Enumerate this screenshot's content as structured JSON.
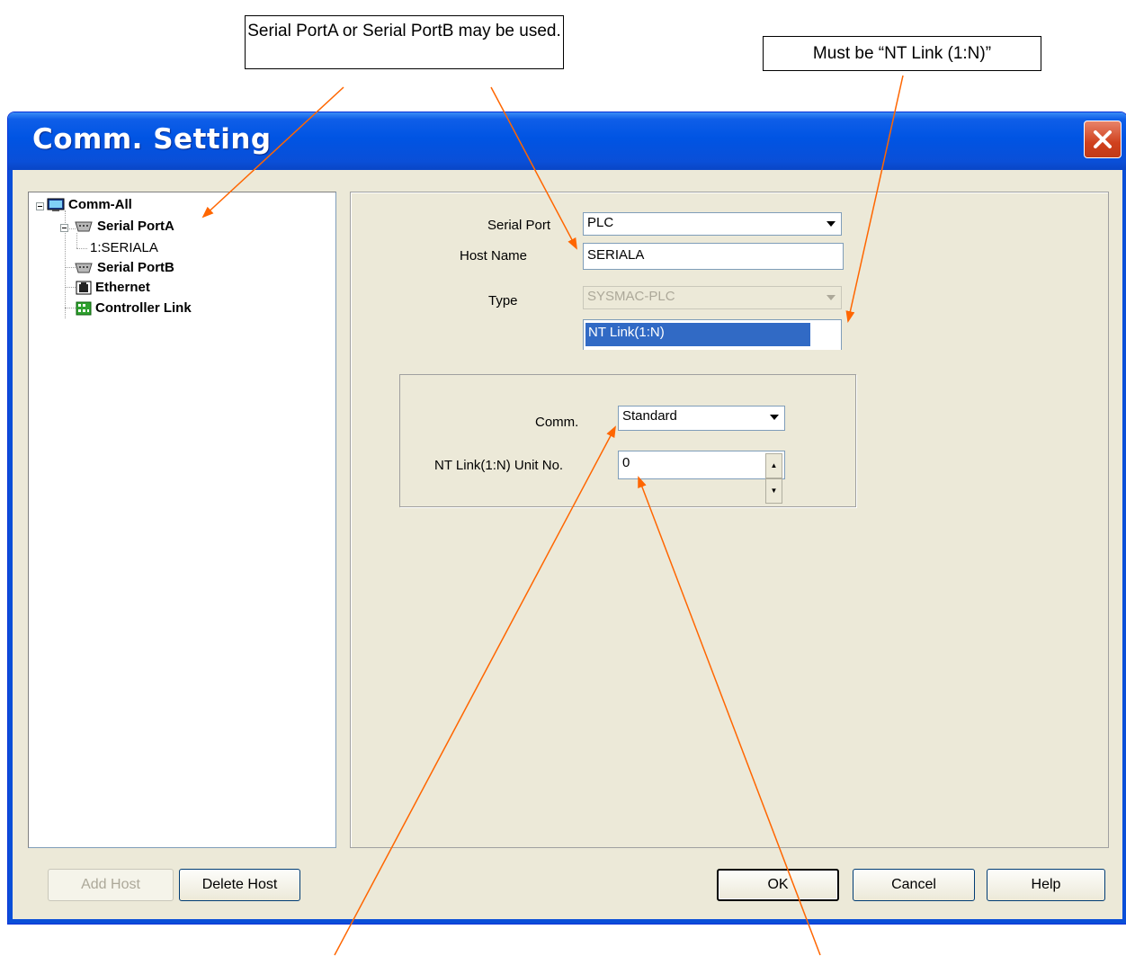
{
  "callouts": {
    "ports": "Serial PortA or Serial PortB may be used.",
    "link": "Must be “NT Link (1:N)”"
  },
  "dialog": {
    "title": "Comm. Setting"
  },
  "tree": {
    "root": "Comm-All",
    "items": [
      {
        "label": "Serial PortA",
        "icon": "serial-port-icon"
      },
      {
        "label": "1:SERIALA",
        "icon": ""
      },
      {
        "label": "Serial PortB",
        "icon": "serial-port-icon"
      },
      {
        "label": "Ethernet",
        "icon": "ethernet-icon"
      },
      {
        "label": "Controller Link",
        "icon": "controller-link-icon"
      }
    ]
  },
  "settings": {
    "serial_port_label": "Serial Port",
    "serial_port_value": "PLC",
    "host_name_label": "Host Name",
    "host_name_value": "SERIALA",
    "type_label": "Type",
    "type_value": "SYSMAC-PLC",
    "protocol_value": "NT Link(1:N)",
    "comm_label": "Comm.",
    "comm_value": "Standard",
    "unit_no_label": "NT Link(1:N) Unit No.",
    "unit_no_value": "0"
  },
  "buttons": {
    "add_host": "Add Host",
    "delete_host": "Delete Host",
    "ok": "OK",
    "cancel": "Cancel",
    "help": "Help"
  },
  "colors": {
    "title_bar": "#0054e3",
    "annotation_arrow": "#ff6600",
    "selection": "#316ac5",
    "dialog_bg": "#ece9d8"
  }
}
